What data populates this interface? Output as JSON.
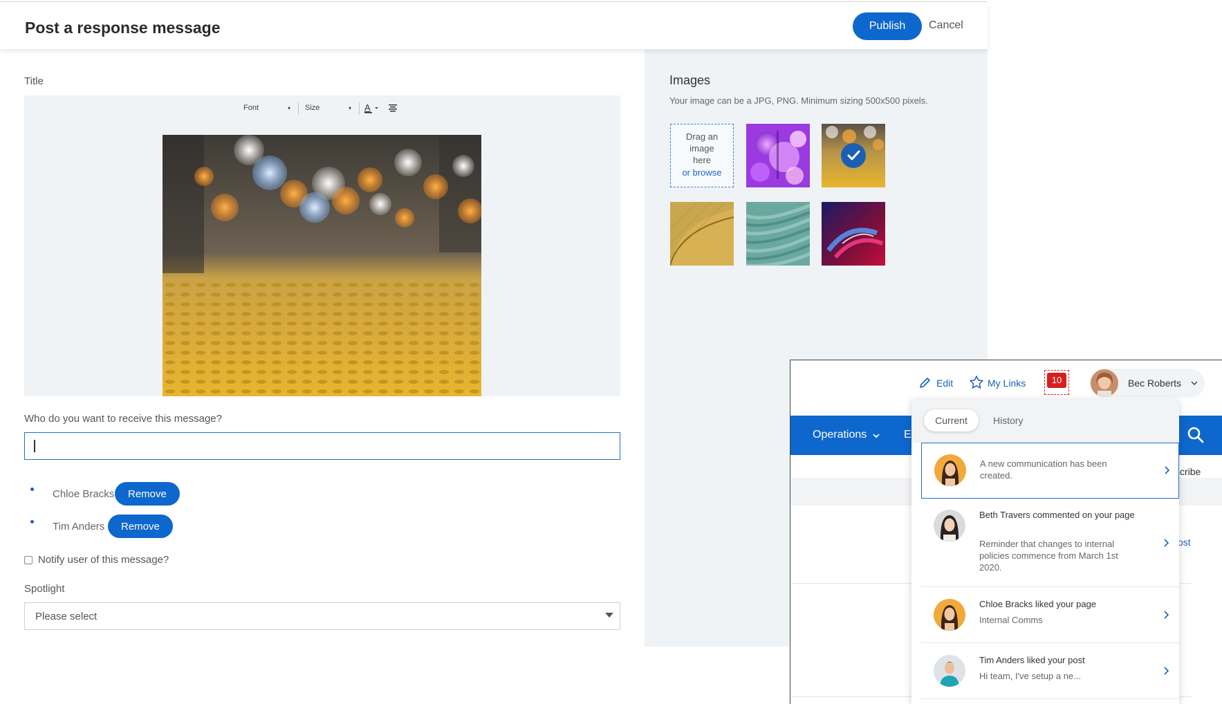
{
  "editor": {
    "title": "Post a response message",
    "publish_label": "Publish",
    "cancel_label": "Cancel",
    "title_field_label": "Title",
    "toolbar": {
      "font_label": "Font",
      "size_label": "Size",
      "color_icon": "text-color-icon",
      "align_icon": "align-center-icon"
    },
    "recipient_question": "Who do you want to receive this message?",
    "recipient_input_value": "",
    "recipients": [
      {
        "name": "Chloe Bracks",
        "remove_label": "Remove"
      },
      {
        "name": "Tim Anders",
        "remove_label": "Remove"
      }
    ],
    "notify_label": "Notify user of this message?",
    "spotlight_label": "Spotlight",
    "spotlight_value": "Please select",
    "accent_color": "#0e67cc"
  },
  "images_panel": {
    "title": "Images",
    "hint": "Your image can be a JPG, PNG. Minimum sizing 500x500 pixels.",
    "drop_line1": "Drag an",
    "drop_line2": "image",
    "drop_line3": "here",
    "drop_browse": "or browse"
  },
  "notifications_window": {
    "edit_label": "Edit",
    "my_links_label": "My Links",
    "notification_count": "10",
    "user_name": "Bec Roberts",
    "nav_item": "Operations",
    "nav_partial": "E",
    "bg_subscribe_partial": "scribe",
    "bg_post_partial": "ost",
    "tabs": {
      "current": "Current",
      "history": "History"
    },
    "items": [
      {
        "title": "",
        "body": "A new communication has been created."
      },
      {
        "title": "Beth Travers commented on your page",
        "body": "Reminder that changes to internal policies commence from March 1st 2020."
      },
      {
        "title": "Chloe Bracks liked your page",
        "body": "Internal Comms"
      },
      {
        "title": "Tim Anders liked your post",
        "body": "Hi team, I've setup a ne..."
      }
    ]
  }
}
